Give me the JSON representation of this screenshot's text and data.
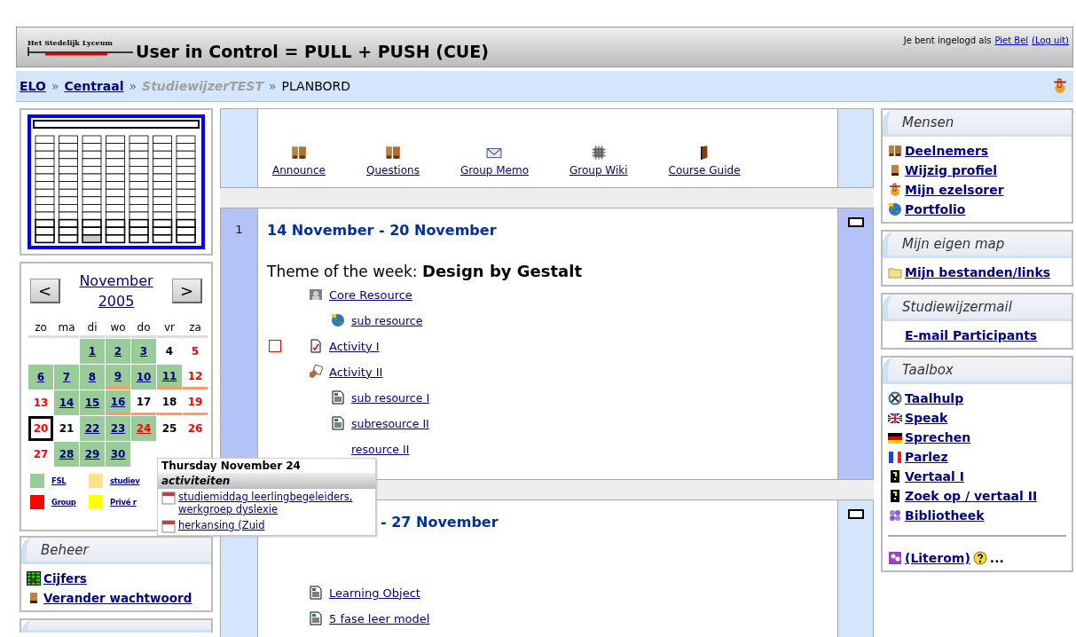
{
  "header": {
    "logo": "Het Stedelijk Lyceum",
    "title": "User in Control = PULL + PUSH (CUE)",
    "login_text": "Je bent ingelogd als",
    "user": "Piet Bel",
    "logout": "(Log uit)"
  },
  "breadcrumb": [
    {
      "label": "ELO",
      "kind": "link"
    },
    {
      "separator": "»",
      "label": "Centraal",
      "kind": "link"
    },
    {
      "separator": "»",
      "label": "StudiewijzerTEST",
      "kind": "muted"
    },
    {
      "separator": "»",
      "label": "PLANBORD",
      "kind": "current"
    }
  ],
  "calendar": {
    "prev": "<",
    "month": "November",
    "year": "2005",
    "next": ">",
    "weekdays": [
      "zo",
      "ma",
      "di",
      "wo",
      "do",
      "vr",
      "za"
    ],
    "days": [
      {
        "kind": "empty"
      },
      {
        "kind": "empty"
      },
      {
        "kind": "day",
        "day": "1",
        "event": true,
        "weekend": false,
        "today": false,
        "marked": false,
        "hovered": false
      },
      {
        "kind": "day",
        "day": "2",
        "event": true,
        "weekend": false,
        "today": false,
        "marked": false,
        "hovered": false
      },
      {
        "kind": "day",
        "day": "3",
        "event": true,
        "weekend": false,
        "today": false,
        "marked": false,
        "hovered": false
      },
      {
        "kind": "day",
        "day": "4",
        "event": false,
        "weekend": false,
        "today": false,
        "marked": false,
        "hovered": false
      },
      {
        "kind": "day",
        "day": "5",
        "event": false,
        "weekend": true,
        "today": false,
        "marked": false,
        "hovered": false
      },
      {
        "kind": "day",
        "day": "6",
        "event": true,
        "weekend": false,
        "today": false,
        "marked": false,
        "hovered": false
      },
      {
        "kind": "day",
        "day": "7",
        "event": true,
        "weekend": false,
        "today": false,
        "marked": false,
        "hovered": false
      },
      {
        "kind": "day",
        "day": "8",
        "event": true,
        "weekend": false,
        "today": false,
        "marked": false,
        "hovered": false
      },
      {
        "kind": "day",
        "day": "9",
        "event": true,
        "weekend": false,
        "today": false,
        "marked": true,
        "hovered": false
      },
      {
        "kind": "day",
        "day": "10",
        "event": true,
        "weekend": false,
        "today": false,
        "marked": false,
        "hovered": false
      },
      {
        "kind": "day",
        "day": "11",
        "event": true,
        "weekend": false,
        "today": false,
        "marked": true,
        "hovered": false
      },
      {
        "kind": "day",
        "day": "12",
        "event": false,
        "weekend": true,
        "today": false,
        "marked": true,
        "hovered": false
      },
      {
        "kind": "day",
        "day": "13",
        "event": false,
        "weekend": true,
        "today": false,
        "marked": false,
        "hovered": false
      },
      {
        "kind": "day",
        "day": "14",
        "event": true,
        "weekend": false,
        "today": false,
        "marked": false,
        "hovered": false
      },
      {
        "kind": "day",
        "day": "15",
        "event": true,
        "weekend": false,
        "today": false,
        "marked": false,
        "hovered": false
      },
      {
        "kind": "day",
        "day": "16",
        "event": true,
        "weekend": false,
        "today": false,
        "marked": true,
        "hovered": false
      },
      {
        "kind": "day",
        "day": "17",
        "event": false,
        "weekend": false,
        "today": false,
        "marked": true,
        "hovered": false
      },
      {
        "kind": "day",
        "day": "18",
        "event": false,
        "weekend": false,
        "today": false,
        "marked": true,
        "hovered": false
      },
      {
        "kind": "day",
        "day": "19",
        "event": false,
        "weekend": true,
        "today": false,
        "marked": true,
        "hovered": false
      },
      {
        "kind": "day",
        "day": "20",
        "event": false,
        "weekend": true,
        "today": true,
        "marked": false,
        "hovered": false
      },
      {
        "kind": "day",
        "day": "21",
        "event": false,
        "weekend": false,
        "today": false,
        "marked": false,
        "hovered": false
      },
      {
        "kind": "day",
        "day": "22",
        "event": true,
        "weekend": false,
        "today": false,
        "marked": false,
        "hovered": false
      },
      {
        "kind": "day",
        "day": "23",
        "event": true,
        "weekend": false,
        "today": false,
        "marked": false,
        "hovered": false
      },
      {
        "kind": "day",
        "day": "24",
        "event": true,
        "weekend": false,
        "today": false,
        "marked": false,
        "hovered": true
      },
      {
        "kind": "day",
        "day": "25",
        "event": false,
        "weekend": false,
        "today": false,
        "marked": false,
        "hovered": false
      },
      {
        "kind": "day",
        "day": "26",
        "event": false,
        "weekend": true,
        "today": false,
        "marked": false,
        "hovered": false
      },
      {
        "kind": "day",
        "day": "27",
        "event": false,
        "weekend": true,
        "today": false,
        "marked": false,
        "hovered": false
      },
      {
        "kind": "day",
        "day": "28",
        "event": true,
        "weekend": false,
        "today": false,
        "marked": false,
        "hovered": false
      },
      {
        "kind": "day",
        "day": "29",
        "event": true,
        "weekend": false,
        "today": false,
        "marked": false,
        "hovered": false
      },
      {
        "kind": "day",
        "day": "30",
        "event": true,
        "weekend": false,
        "today": false,
        "marked": false,
        "hovered": false
      }
    ],
    "legend": [
      {
        "label": "FSL",
        "color": "#99cc99"
      },
      {
        "label": "studiev",
        "color": "#ffe08a"
      },
      {
        "label": "Group",
        "color": "#ff0000"
      },
      {
        "label": "Privé r",
        "color": "#ffff00"
      }
    ]
  },
  "tooltip": {
    "title": "Thursday November 24",
    "header": "activiteiten",
    "entries": [
      {
        "label": "studiemiddag leerlingbegeleiders, werkgroep dyslexie"
      },
      {
        "label": "herkansing (Zuid"
      }
    ]
  },
  "beheer": {
    "title": "Beheer",
    "items": [
      {
        "label": "Cijfers",
        "kind": "grid"
      },
      {
        "label": "Verander wachtwoord",
        "kind": "person"
      }
    ]
  },
  "toplinks": [
    {
      "label": "Announce",
      "kind": "people"
    },
    {
      "label": "Questions",
      "kind": "people"
    },
    {
      "label": "Group Memo",
      "kind": "envelope"
    },
    {
      "label": "Group Wiki",
      "kind": "chip"
    },
    {
      "label": "Course Guide",
      "kind": "book"
    }
  ],
  "sections": [
    {
      "number": "1",
      "current": true,
      "heading": "14 November - 20 November",
      "theme": "Theme of the week: **Design by Gestalt**",
      "items": [
        {
          "label": "Core Resource",
          "kind": "user",
          "has_checkbox": false,
          "children": [
            {
              "label": "sub resource",
              "kind": "globe",
              "has_checkbox": false
            }
          ]
        },
        {
          "label": "Activity I",
          "kind": "assignment",
          "has_checkbox": true,
          "checked": false
        },
        {
          "label": "Activity II",
          "kind": "workshop",
          "has_checkbox": false,
          "children": [
            {
              "label": "sub resource I",
              "kind": "doc",
              "has_checkbox": false
            },
            {
              "label": "subresource II",
              "kind": "doc",
              "has_checkbox": false
            },
            {
              "label": "resource II",
              "kind": "plain",
              "has_checkbox": false
            }
          ]
        }
      ]
    },
    {
      "current": false,
      "heading": "- 27 November",
      "items": [
        {
          "label": "Learning Object",
          "kind": "doc",
          "has_checkbox": false
        },
        {
          "label": "5 fase leer model",
          "kind": "doc",
          "has_checkbox": false
        }
      ]
    }
  ],
  "blocks": [
    {
      "title": "Mensen",
      "items": [
        {
          "label": "Deelnemers",
          "kind": "people"
        },
        {
          "label": "Wijzig profiel",
          "kind": "person"
        },
        {
          "label": "Mijn ezelsorer",
          "kind": "hand"
        },
        {
          "label": "Portfolio",
          "kind": "globe"
        }
      ]
    },
    {
      "title": "Mijn eigen map",
      "items": [
        {
          "label": "Mijn bestanden/links",
          "kind": "folder"
        }
      ]
    },
    {
      "title": "Studiewijzermail",
      "items": [
        {
          "label": "E-mail Participants",
          "kind": "plain"
        }
      ]
    },
    {
      "title": "Taalbox",
      "items": [
        {
          "label": "Taalhulp",
          "kind": "lifebuoy"
        },
        {
          "label": "Speak",
          "kind": "uk"
        },
        {
          "label": "Sprechen",
          "kind": "de"
        },
        {
          "label": "Parlez",
          "kind": "fr"
        },
        {
          "label": "Vertaal I",
          "kind": "question"
        },
        {
          "label": "Zoek op / vertaal II",
          "kind": "question"
        },
        {
          "label": "Bibliotheek",
          "kind": "flower"
        },
        {
          "label": "(Literom)",
          "kind": "tile",
          "rule": true,
          "extra": "..."
        }
      ]
    }
  ]
}
